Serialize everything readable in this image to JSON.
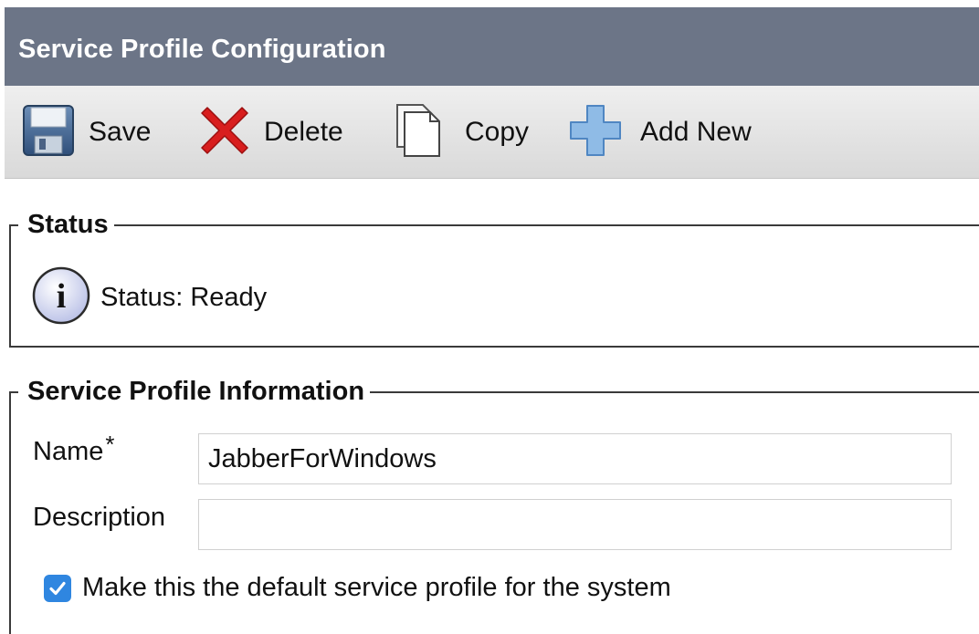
{
  "header": {
    "title": "Service Profile Configuration"
  },
  "toolbar": {
    "save_label": "Save",
    "delete_label": "Delete",
    "copy_label": "Copy",
    "add_new_label": "Add New",
    "icons": {
      "save": "floppy-disk-icon",
      "delete": "red-x-icon",
      "copy": "copy-documents-icon",
      "add_new": "plus-icon"
    }
  },
  "status_section": {
    "legend": "Status",
    "text": "Status: Ready",
    "icon": "info-icon"
  },
  "info_section": {
    "legend": "Service Profile Information",
    "name_label": "Name",
    "required_marker": "*",
    "name_value": "JabberForWindows",
    "description_label": "Description",
    "description_value": "",
    "default_checkbox_label": "Make this the default service profile for the system",
    "default_checked": true
  },
  "colors": {
    "title_bar": "#6c7587",
    "delete_red": "#d81e1e",
    "add_blue": "#7fb0e0",
    "checkbox_blue": "#2f86e0"
  }
}
